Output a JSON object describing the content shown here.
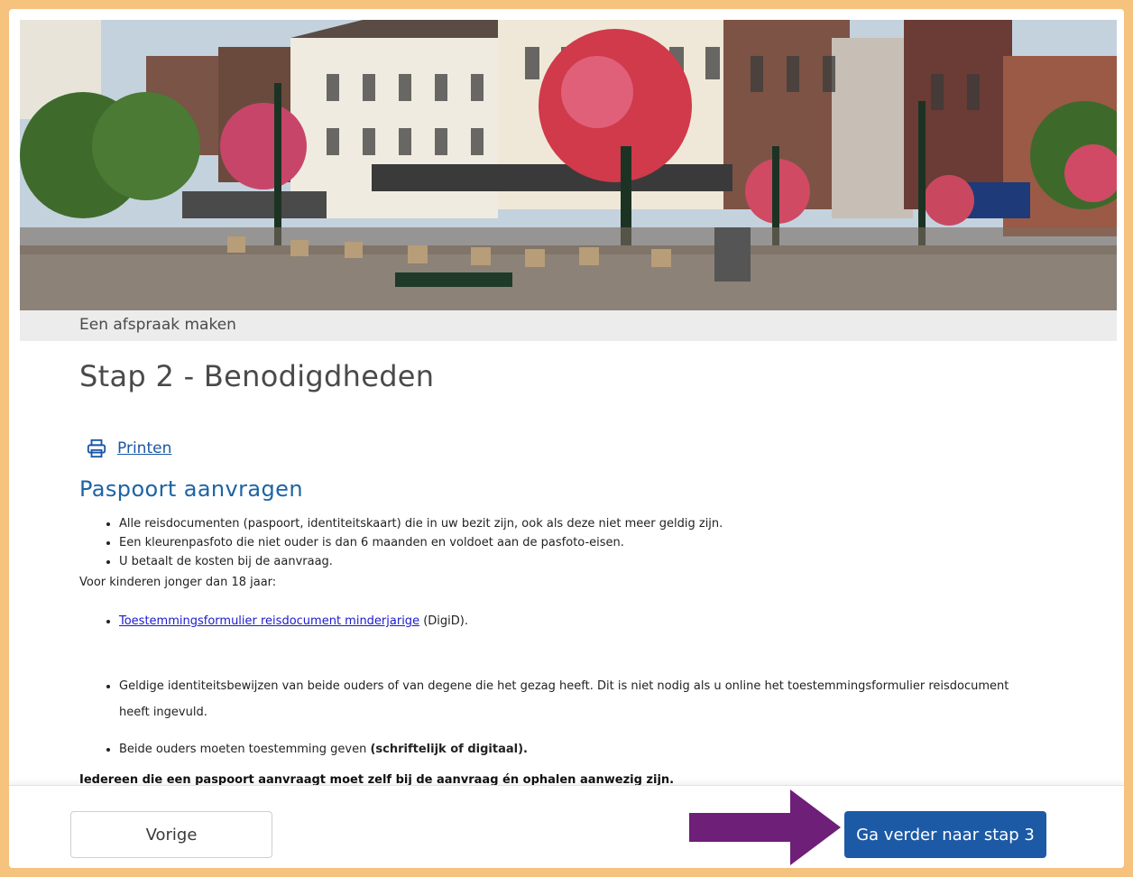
{
  "breadcrumb": "Een afspraak maken",
  "page_title": "Stap 2 - Benodigdheden",
  "print_label": "Printen",
  "section_title": "Paspoort aanvragen",
  "requirements": [
    "Alle reisdocumenten (paspoort, identiteitskaart) die in uw bezit zijn, ook als deze niet meer geldig zijn.",
    "Een kleurenpasfoto die niet ouder is dan 6 maanden en voldoet aan de pasfoto-eisen.",
    "U betaalt de kosten bij de aanvraag."
  ],
  "kids_label": "Voor kinderen jonger dan 18 jaar:",
  "kids_form_link": "Toestemmingsformulier reisdocument minderjarige",
  "kids_form_suffix": " (DigiD).",
  "kids_items": [
    "Geldige identiteitsbewijzen van beide ouders of van degene die het gezag heeft. Dit is niet nodig als u online het toestemmingsformulier reisdocument heeft ingevuld.",
    "Beide ouders moeten toestemming geven "
  ],
  "kids_items_bold": "(schriftelijk of digitaal).",
  "footnote": "Iedereen die een paspoort aanvraagt moet zelf bij de aanvraag én ophalen aanwezig zijn.",
  "buttons": {
    "prev": "Vorige",
    "next": "Ga verder naar stap 3"
  },
  "colors": {
    "frame": "#f6c37e",
    "accent": "#1c5aa6",
    "arrow": "#6e1f77",
    "section": "#1d63a4"
  },
  "icons": {
    "print": "printer-icon",
    "arrow": "arrow-right-icon"
  }
}
